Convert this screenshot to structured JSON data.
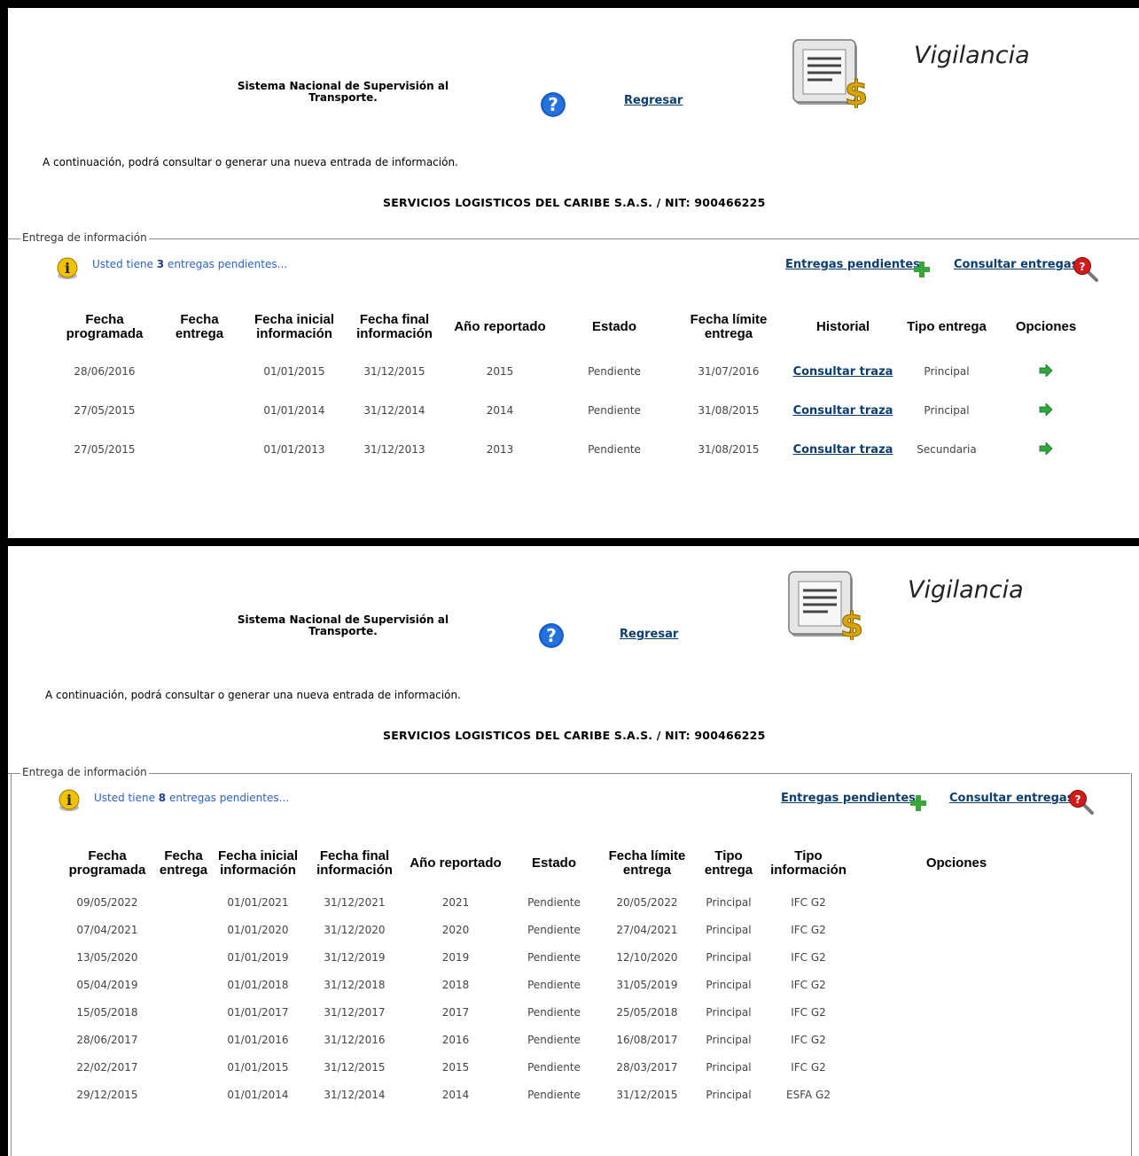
{
  "header": {
    "system_title": "Sistema Nacional de Supervisión al Transporte.",
    "back_link": "Regresar",
    "module_title": "Vigilancia",
    "intro_text": "A continuación, podrá consultar o generar una nueva entrada de información.",
    "company": "SERVICIOS LOGISTICOS DEL CARIBE S.A.S. / NIT: 900466225"
  },
  "section_legend": "Entrega de información",
  "actions": {
    "pending_link": "Entregas pendientes",
    "consult_link": "Consultar entregas"
  },
  "panel1": {
    "pending_prefix": "Usted tiene ",
    "pending_count": "3",
    "pending_suffix": " entregas pendientes...",
    "columns": [
      "Fecha programada",
      "Fecha entrega",
      "Fecha inicial información",
      "Fecha final información",
      "Año reportado",
      "Estado",
      "Fecha límite entrega",
      "Historial",
      "Tipo entrega",
      "Opciones"
    ],
    "rows": [
      {
        "programada": "28/06/2016",
        "entrega": "",
        "inicial": "01/01/2015",
        "final": "31/12/2015",
        "anio": "2015",
        "estado": "Pendiente",
        "limite": "31/07/2016",
        "historial": "Consultar traza",
        "tipo": "Principal"
      },
      {
        "programada": "27/05/2015",
        "entrega": "",
        "inicial": "01/01/2014",
        "final": "31/12/2014",
        "anio": "2014",
        "estado": "Pendiente",
        "limite": "31/08/2015",
        "historial": "Consultar traza",
        "tipo": "Principal"
      },
      {
        "programada": "27/05/2015",
        "entrega": "",
        "inicial": "01/01/2013",
        "final": "31/12/2013",
        "anio": "2013",
        "estado": "Pendiente",
        "limite": "31/08/2015",
        "historial": "Consultar traza",
        "tipo": "Secundaria"
      }
    ]
  },
  "panel2": {
    "pending_prefix": "Usted tiene ",
    "pending_count": "8",
    "pending_suffix": " entregas pendientes...",
    "columns": [
      "Fecha programada",
      "Fecha entrega",
      "Fecha inicial información",
      "Fecha final información",
      "Año reportado",
      "Estado",
      "Fecha límite entrega",
      "Tipo entrega",
      "Tipo información",
      "Opciones"
    ],
    "rows": [
      {
        "programada": "09/05/2022",
        "entrega": "",
        "inicial": "01/01/2021",
        "final": "31/12/2021",
        "anio": "2021",
        "estado": "Pendiente",
        "limite": "20/05/2022",
        "tipo": "Principal",
        "info": "IFC G2"
      },
      {
        "programada": "07/04/2021",
        "entrega": "",
        "inicial": "01/01/2020",
        "final": "31/12/2020",
        "anio": "2020",
        "estado": "Pendiente",
        "limite": "27/04/2021",
        "tipo": "Principal",
        "info": "IFC G2"
      },
      {
        "programada": "13/05/2020",
        "entrega": "",
        "inicial": "01/01/2019",
        "final": "31/12/2019",
        "anio": "2019",
        "estado": "Pendiente",
        "limite": "12/10/2020",
        "tipo": "Principal",
        "info": "IFC G2"
      },
      {
        "programada": "05/04/2019",
        "entrega": "",
        "inicial": "01/01/2018",
        "final": "31/12/2018",
        "anio": "2018",
        "estado": "Pendiente",
        "limite": "31/05/2019",
        "tipo": "Principal",
        "info": "IFC G2"
      },
      {
        "programada": "15/05/2018",
        "entrega": "",
        "inicial": "01/01/2017",
        "final": "31/12/2017",
        "anio": "2017",
        "estado": "Pendiente",
        "limite": "25/05/2018",
        "tipo": "Principal",
        "info": "IFC G2"
      },
      {
        "programada": "28/06/2017",
        "entrega": "",
        "inicial": "01/01/2016",
        "final": "31/12/2016",
        "anio": "2016",
        "estado": "Pendiente",
        "limite": "16/08/2017",
        "tipo": "Principal",
        "info": "IFC G2"
      },
      {
        "programada": "22/02/2017",
        "entrega": "",
        "inicial": "01/01/2015",
        "final": "31/12/2015",
        "anio": "2015",
        "estado": "Pendiente",
        "limite": "28/03/2017",
        "tipo": "Principal",
        "info": "IFC G2"
      },
      {
        "programada": "29/12/2015",
        "entrega": "",
        "inicial": "01/01/2014",
        "final": "31/12/2014",
        "anio": "2014",
        "estado": "Pendiente",
        "limite": "31/12/2015",
        "tipo": "Principal",
        "info": "ESFA G2"
      }
    ]
  },
  "icons": {
    "help": "question-circle-icon",
    "module": "document-dollar-icon",
    "info": "info-icon",
    "add": "plus-icon",
    "search": "search-icon",
    "go": "arrow-right-icon"
  },
  "colors": {
    "link": "#0b3d6e",
    "pending_text": "#2a63c8",
    "help_blue": "#1a5fc8",
    "add_green": "#3aa63a",
    "arrow_green": "#2eaa3a"
  }
}
